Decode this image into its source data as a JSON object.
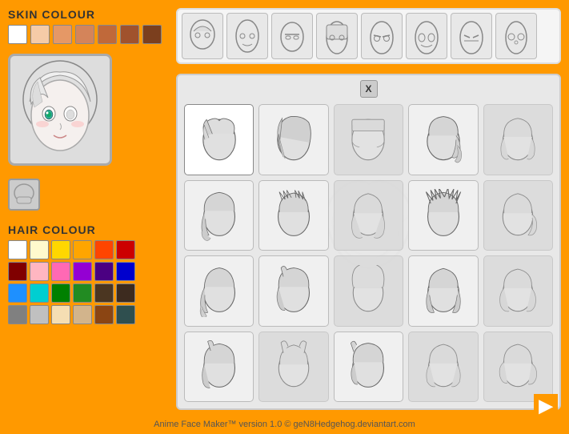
{
  "app": {
    "title": "Anime Face Maker™ version 1.0 © geN8Hedgehog.deviantart.com",
    "background_color": "#FF9900"
  },
  "skin_colour": {
    "label": "SKIN COLOUR",
    "swatches": [
      "#FFFFFF",
      "#F5CBA7",
      "#E59866",
      "#D4845A",
      "#C0693A",
      "#A0522D",
      "#7B3F1E"
    ]
  },
  "hair_colour": {
    "label": "HAIR COLOUR",
    "current_swatch": "#CCCCCC",
    "swatches": [
      "#FFFFFF",
      "#FFFACD",
      "#FFD700",
      "#FFA500",
      "#FF4500",
      "#CC0000",
      "#800000",
      "#FFB6C1",
      "#FF69B4",
      "#9400D3",
      "#4B0082",
      "#0000CD",
      "#1E90FF",
      "#00CED1",
      "#008000",
      "#228B22",
      "#4B3621",
      "#3D2B1F",
      "#808080",
      "#C0C0C0",
      "#F5DEB3",
      "#D2B48C",
      "#8B4513",
      "#2F4F4F"
    ]
  },
  "face_types": {
    "count": 8,
    "selected": 0
  },
  "hair_styles": {
    "count": 20,
    "selected": 0,
    "close_label": "X"
  },
  "footer": {
    "text": "Anime Face Maker™ version 1.0 © geN8Hedgehog.deviantart.com"
  },
  "navigation": {
    "next_label": "▶"
  }
}
